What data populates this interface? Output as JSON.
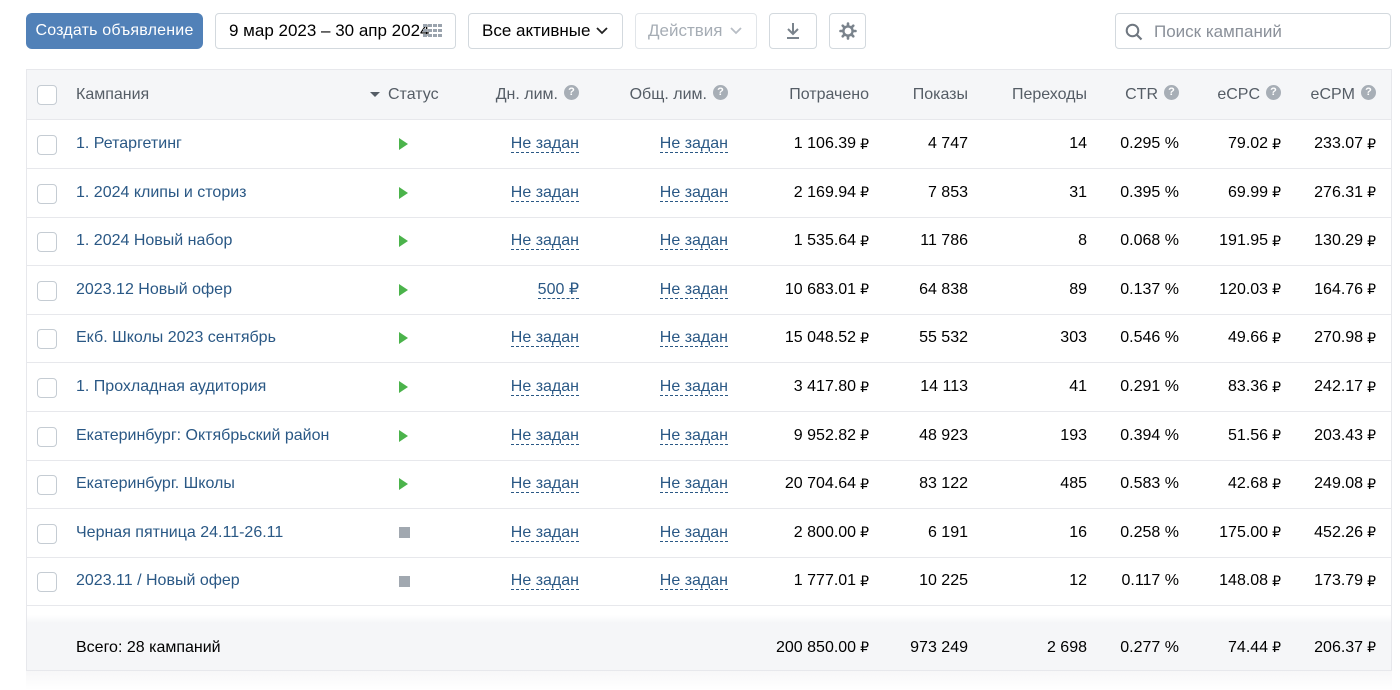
{
  "toolbar": {
    "create_label": "Создать объявление",
    "date_range": "9 мар 2023 – 30 апр 2024",
    "status_filter": "Все активные",
    "actions_label": "Действия",
    "search_placeholder": "Поиск кампаний",
    "icons": [
      "calendar-grid-icon",
      "chevron-down-icon",
      "download-icon",
      "gear-icon",
      "search-icon"
    ]
  },
  "colors": {
    "accent": "#5181b8",
    "link": "#2a5885",
    "running": "#4bb34b",
    "stopped": "#a1a8b0",
    "header_bg": "#f5f6f8"
  },
  "currency": "₽",
  "columns": {
    "name": "Кампания",
    "status": "Статус",
    "day_limit": "Дн. лим.",
    "total_limit": "Общ. лим.",
    "spent": "Потрачено",
    "shows": "Показы",
    "clicks": "Переходы",
    "ctr": "CTR",
    "ecpc": "eCPC",
    "ecpm": "eCPM"
  },
  "rows": [
    {
      "name": "1. Ретаргетинг",
      "status": "running",
      "day_limit": "Не задан",
      "total_limit": "Не задан",
      "spent": "1 106.39",
      "shows": "4 747",
      "clicks": "14",
      "ctr": "0.295 %",
      "ecpc": "79.02",
      "ecpm": "233.07"
    },
    {
      "name": "1. 2024 клипы и сториз",
      "status": "running",
      "day_limit": "Не задан",
      "total_limit": "Не задан",
      "spent": "2 169.94",
      "shows": "7 853",
      "clicks": "31",
      "ctr": "0.395 %",
      "ecpc": "69.99",
      "ecpm": "276.31"
    },
    {
      "name": "1. 2024 Новый набор",
      "status": "running",
      "day_limit": "Не задан",
      "total_limit": "Не задан",
      "spent": "1 535.64",
      "shows": "11 786",
      "clicks": "8",
      "ctr": "0.068 %",
      "ecpc": "191.95",
      "ecpm": "130.29"
    },
    {
      "name": "2023.12 Новый офер",
      "status": "running",
      "day_limit": "500 ₽",
      "total_limit": "Не задан",
      "spent": "10 683.01",
      "shows": "64 838",
      "clicks": "89",
      "ctr": "0.137 %",
      "ecpc": "120.03",
      "ecpm": "164.76"
    },
    {
      "name": "Екб. Школы 2023 сентябрь",
      "status": "running",
      "day_limit": "Не задан",
      "total_limit": "Не задан",
      "spent": "15 048.52",
      "shows": "55 532",
      "clicks": "303",
      "ctr": "0.546 %",
      "ecpc": "49.66",
      "ecpm": "270.98"
    },
    {
      "name": "1. Прохладная аудитория",
      "status": "running",
      "day_limit": "Не задан",
      "total_limit": "Не задан",
      "spent": "3 417.80",
      "shows": "14 113",
      "clicks": "41",
      "ctr": "0.291 %",
      "ecpc": "83.36",
      "ecpm": "242.17"
    },
    {
      "name": "Екатеринбург: Октябрьский район",
      "status": "running",
      "day_limit": "Не задан",
      "total_limit": "Не задан",
      "spent": "9 952.82",
      "shows": "48 923",
      "clicks": "193",
      "ctr": "0.394 %",
      "ecpc": "51.56",
      "ecpm": "203.43"
    },
    {
      "name": "Екатеринбург. Школы",
      "status": "running",
      "day_limit": "Не задан",
      "total_limit": "Не задан",
      "spent": "20 704.64",
      "shows": "83 122",
      "clicks": "485",
      "ctr": "0.583 %",
      "ecpc": "42.68",
      "ecpm": "249.08"
    },
    {
      "name": "Черная пятница 24.11-26.11",
      "status": "stopped",
      "day_limit": "Не задан",
      "total_limit": "Не задан",
      "spent": "2 800.00",
      "shows": "6 191",
      "clicks": "16",
      "ctr": "0.258 %",
      "ecpc": "175.00",
      "ecpm": "452.26"
    },
    {
      "name": "2023.11 / Новый офер",
      "status": "stopped",
      "day_limit": "Не задан",
      "total_limit": "Не задан",
      "spent": "1 777.01",
      "shows": "10 225",
      "clicks": "12",
      "ctr": "0.117 %",
      "ecpc": "148.08",
      "ecpm": "173.79"
    }
  ],
  "footer": {
    "total_label": "Всего: 28 кампаний",
    "spent": "200 850.00",
    "shows": "973 249",
    "clicks": "2 698",
    "ctr": "0.277 %",
    "ecpc": "74.44",
    "ecpm": "206.37"
  }
}
